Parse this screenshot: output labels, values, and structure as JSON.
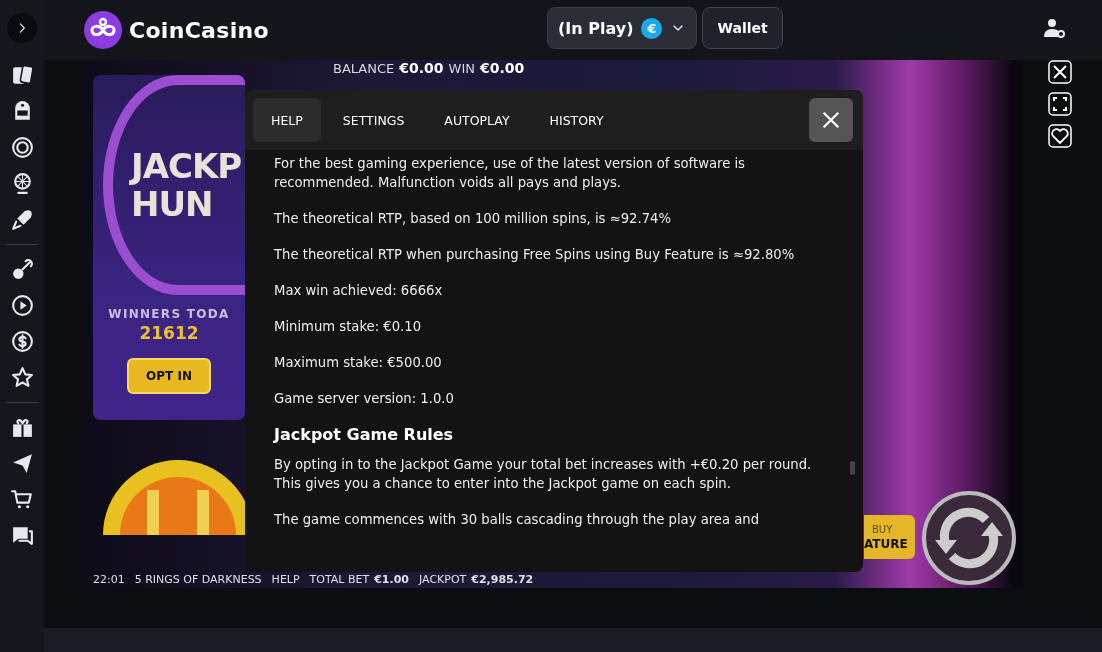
{
  "header": {
    "logo": "CoinCasino",
    "balance_selector": "(In Play)",
    "currency": "€",
    "wallet": "Wallet"
  },
  "game": {
    "balance_label": "BALANCE",
    "balance": "€0.00",
    "win_label": "WIN",
    "win": "€0.00",
    "promo": {
      "logo_lines": [
        "JACKP",
        "HUN"
      ],
      "winners_label": "WINNERS TODA",
      "winners": "21612",
      "button": "OPT IN"
    },
    "buy_feature": [
      "BUY",
      "ATURE"
    ],
    "status_bar": [
      {
        "text": "22:01"
      },
      {
        "text": "5 RINGS OF DARKNESS"
      },
      {
        "text": "HELP"
      },
      {
        "text": "TOTAL BET",
        "value": "€1.00"
      },
      {
        "text": "JACKPOT",
        "value": "€2,985.72"
      }
    ]
  },
  "help_dialog": {
    "tabs": [
      {
        "label": "HELP",
        "selected": true
      },
      {
        "label": "SETTINGS",
        "selected": false
      },
      {
        "label": "AUTOPLAY",
        "selected": false
      },
      {
        "label": "HISTORY",
        "selected": false
      }
    ],
    "paragraphs": [
      {
        "kind": "text",
        "text": "For the best gaming experience, use of the latest version of software is recommended. Malfunction voids all pays and plays."
      },
      {
        "kind": "text",
        "text": "The theoretical RTP, based on 100 million spins, is ≈92.74%"
      },
      {
        "kind": "text",
        "text": "The theoretical RTP when purchasing Free Spins using Buy Feature is ≈92.80%"
      },
      {
        "kind": "text",
        "text": "Max win achieved: 6666x"
      },
      {
        "kind": "text",
        "text": "Minimum stake: €0.10"
      },
      {
        "kind": "text",
        "text": "Maximum stake: €500.00"
      },
      {
        "kind": "text",
        "text": "Game server version: 1.0.0"
      },
      {
        "kind": "heading",
        "text": "Jackpot Game Rules"
      },
      {
        "kind": "text",
        "text": "By opting in to the Jackpot Game your total bet increases with +€0.20 per round. This gives you a chance to enter into the Jackpot game on each spin."
      },
      {
        "kind": "text",
        "text": "The game commences with 30 balls cascading through the play area and"
      }
    ]
  }
}
